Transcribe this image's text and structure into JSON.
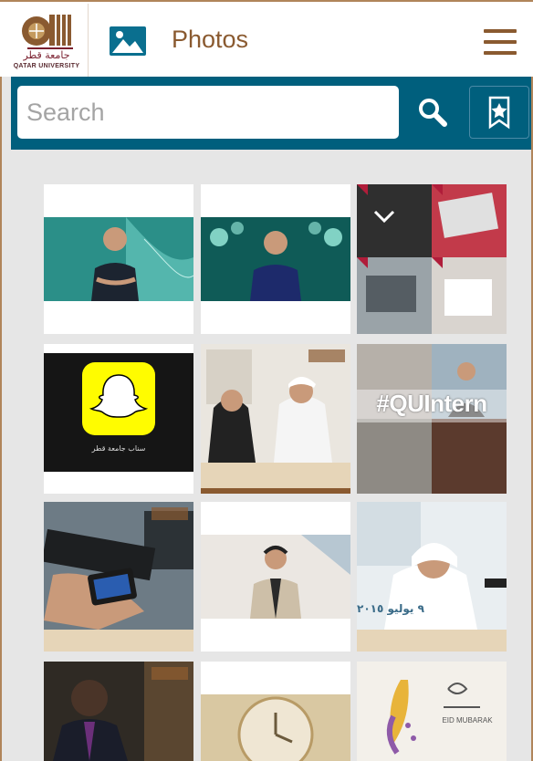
{
  "header": {
    "logo_ar": "جامعة قطر",
    "logo_en": "QATAR UNIVERSITY",
    "title": "Photos",
    "photos_icon": "image-icon",
    "menu_icon": "hamburger-menu-icon"
  },
  "search": {
    "placeholder": "Search",
    "value": "",
    "search_icon": "search-icon",
    "bookmark_icon": "bookmark-star-icon"
  },
  "photos": {
    "tiles": [
      {
        "overlay_text": ""
      },
      {
        "overlay_text": ""
      },
      {
        "overlay_text": ""
      },
      {
        "overlay_text": "سناب جامعة قطر"
      },
      {
        "overlay_text": ""
      },
      {
        "overlay_text": "#QUIntern"
      },
      {
        "overlay_text": ""
      },
      {
        "overlay_text": ""
      },
      {
        "overlay_text": "٩ يوليو ٢٠١٥"
      },
      {
        "overlay_text": ""
      },
      {
        "overlay_text": ""
      },
      {
        "overlay_text": "EID MUBARAK"
      }
    ]
  },
  "colors": {
    "brand_brown": "#8a5a30",
    "search_bar": "#005f7d",
    "background": "#e6e6e6"
  }
}
